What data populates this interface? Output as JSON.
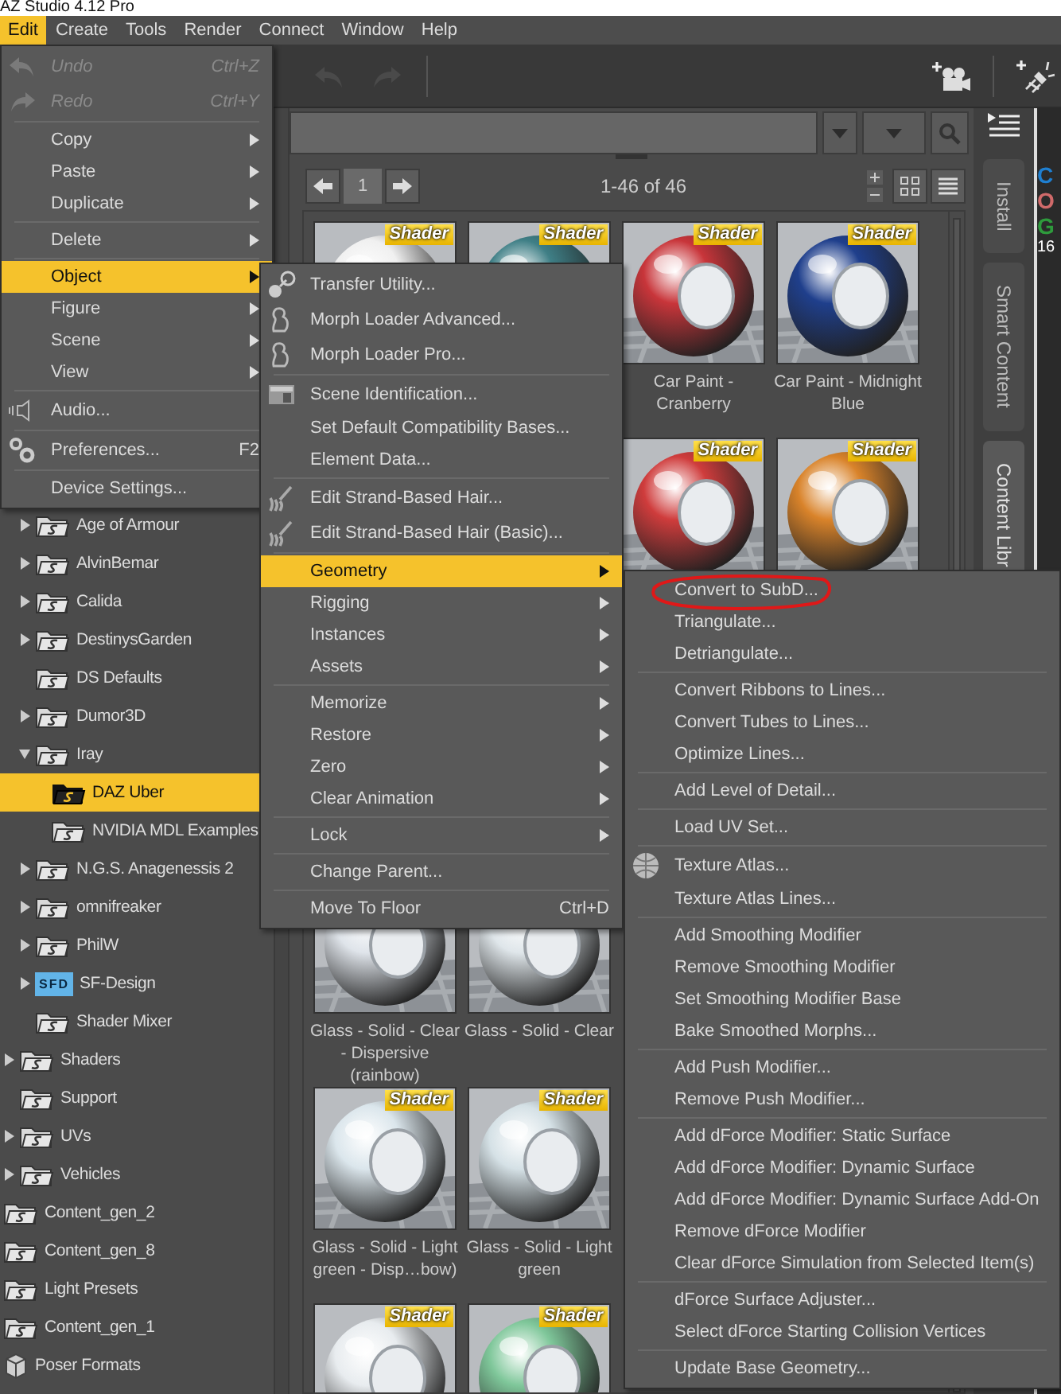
{
  "window": {
    "title": "AZ Studio 4.12 Pro"
  },
  "menubar": [
    {
      "label": "Edit",
      "selected": true
    },
    {
      "label": "Create",
      "selected": false
    },
    {
      "label": "Tools",
      "selected": false
    },
    {
      "label": "Render",
      "selected": false
    },
    {
      "label": "Connect",
      "selected": false
    },
    {
      "label": "Window",
      "selected": false
    },
    {
      "label": "Help",
      "selected": false
    }
  ],
  "tree": [
    {
      "children": [
        {
          "children": [
            {
              "label": "Age of Armour",
              "expanded": false,
              "selected": false,
              "kind": "folder"
            },
            {
              "label": "AlvinBemar",
              "expanded": false,
              "selected": false,
              "kind": "folder"
            },
            {
              "label": "Calida",
              "expanded": false,
              "selected": false,
              "kind": "folder"
            },
            {
              "label": "DestinysGarden",
              "expanded": false,
              "selected": false,
              "kind": "folder"
            },
            {
              "label": "DS Defaults",
              "selected": false,
              "kind": "folder"
            },
            {
              "label": "Dumor3D",
              "expanded": false,
              "selected": false,
              "kind": "folder"
            },
            {
              "label": "Iray",
              "expanded": true,
              "selected": false,
              "kind": "folder",
              "children": [
                {
                  "label": "DAZ Uber",
                  "selected": true,
                  "kind": "folder"
                },
                {
                  "label": "NVIDIA MDL Examples",
                  "selected": false,
                  "kind": "folder"
                }
              ]
            },
            {
              "label": "N.G.S. Anagenessis 2",
              "expanded": false,
              "selected": false,
              "kind": "folder"
            },
            {
              "label": "omnifreaker",
              "expanded": false,
              "selected": false,
              "kind": "folder"
            },
            {
              "label": "PhilW",
              "expanded": false,
              "selected": false,
              "kind": "folder"
            },
            {
              "label": "SF-Design",
              "expanded": false,
              "selected": false,
              "kind": "logo",
              "logo": "SFD"
            },
            {
              "label": "Shader Mixer",
              "selected": false,
              "kind": "folder"
            }
          ]
        },
        {
          "label": "Shaders",
          "expanded": false,
          "selected": false,
          "kind": "folder"
        },
        {
          "label": "Support",
          "selected": false,
          "kind": "folder"
        },
        {
          "label": "UVs",
          "expanded": false,
          "selected": false,
          "kind": "folder"
        },
        {
          "label": "Vehicles",
          "expanded": false,
          "selected": false,
          "kind": "folder"
        }
      ]
    },
    {
      "label": "Content_gen_2",
      "selected": false,
      "kind": "folder"
    },
    {
      "label": "Content_gen_8",
      "selected": false,
      "kind": "folder"
    },
    {
      "label": "Light Presets",
      "selected": false,
      "kind": "folder"
    },
    {
      "label": "Content_gen_1",
      "selected": false,
      "kind": "folder"
    },
    {
      "label": "Poser Formats",
      "selected": false,
      "kind": "package"
    }
  ],
  "pagination": {
    "page": "1",
    "range": "1-46 of 46"
  },
  "tiles": [
    {
      "kind": "shader",
      "badge": "Shader"
    },
    {
      "kind": "shader",
      "badge": "Shader"
    },
    {
      "kind": "shader",
      "badge": "Shader",
      "label": "Car Paint - Cranberry"
    },
    {
      "kind": "shader",
      "badge": "Shader",
      "label": "Car Paint - Midnight Blue"
    },
    {
      "kind": "covered"
    },
    {
      "kind": "covered"
    },
    {
      "kind": "shader",
      "badge": "Shader"
    },
    {
      "kind": "shader",
      "badge": "Shader"
    },
    {
      "kind": "covered"
    },
    {
      "kind": "covered"
    },
    {
      "kind": "covered"
    },
    {
      "kind": "covered"
    },
    {
      "kind": "shader-lower",
      "label": "Glass - Solid - Clear - Dispersive (rainbow)"
    },
    {
      "kind": "shader-lower",
      "label": "Glass - Solid - Clear"
    },
    {
      "kind": "covered"
    },
    {
      "kind": "covered"
    },
    {
      "kind": "shader",
      "badge": "Shader",
      "label": "Glass - Solid - Light green - Disp…bow)"
    },
    {
      "kind": "shader",
      "badge": "Shader",
      "label": "Glass - Solid - Light green"
    },
    {
      "kind": "covered"
    },
    {
      "kind": "covered"
    },
    {
      "kind": "shader",
      "badge": "Shader"
    },
    {
      "kind": "shader",
      "badge": "Shader"
    }
  ],
  "side_tabs": [
    {
      "label": "Install",
      "selected": false
    },
    {
      "label": "Smart Content",
      "selected": false
    },
    {
      "label": "Content Libr",
      "selected": true
    }
  ],
  "viewport": {
    "labels": [
      {
        "text": "C",
        "color": "#1f7fd0"
      },
      {
        "text": "O",
        "color": "#d06a6a"
      },
      {
        "text": "G",
        "color": "#2e9a3c"
      }
    ],
    "counter": "16"
  },
  "edit_menu": {
    "items": [
      {
        "kind": "item",
        "label": "Undo",
        "shortcut": "Ctrl+Z",
        "disabled": true,
        "selected": false,
        "submenu": false
      },
      {
        "kind": "item",
        "label": "Redo",
        "shortcut": "Ctrl+Y",
        "disabled": true,
        "selected": false,
        "submenu": false
      },
      {
        "kind": "separator"
      },
      {
        "kind": "item",
        "label": "Copy",
        "disabled": false,
        "selected": false,
        "submenu": true
      },
      {
        "kind": "item",
        "label": "Paste",
        "disabled": false,
        "selected": false,
        "submenu": true
      },
      {
        "kind": "item",
        "label": "Duplicate",
        "disabled": false,
        "selected": false,
        "submenu": true
      },
      {
        "kind": "separator"
      },
      {
        "kind": "item",
        "label": "Delete",
        "disabled": false,
        "selected": false,
        "submenu": true
      },
      {
        "kind": "separator"
      },
      {
        "kind": "item",
        "label": "Object",
        "disabled": false,
        "selected": true,
        "submenu": true
      },
      {
        "kind": "item",
        "label": "Figure",
        "disabled": false,
        "selected": false,
        "submenu": true
      },
      {
        "kind": "item",
        "label": "Scene",
        "disabled": false,
        "selected": false,
        "submenu": true
      },
      {
        "kind": "item",
        "label": "View",
        "disabled": false,
        "selected": false,
        "submenu": true
      },
      {
        "kind": "separator"
      },
      {
        "kind": "item",
        "label": "Audio...",
        "disabled": false,
        "selected": false,
        "submenu": false
      },
      {
        "kind": "separator"
      },
      {
        "kind": "item",
        "label": "Preferences...",
        "shortcut": "F2",
        "disabled": false,
        "selected": false,
        "submenu": false
      },
      {
        "kind": "separator"
      },
      {
        "kind": "item",
        "label": "Device Settings...",
        "disabled": false,
        "selected": false,
        "submenu": false
      }
    ]
  },
  "object_menu": {
    "items": [
      {
        "kind": "item",
        "label": "Transfer Utility...",
        "disabled": false,
        "selected": false,
        "submenu": false
      },
      {
        "kind": "item",
        "label": "Morph Loader Advanced...",
        "disabled": false,
        "selected": false,
        "submenu": false
      },
      {
        "kind": "item",
        "label": "Morph Loader Pro...",
        "disabled": false,
        "selected": false,
        "submenu": false
      },
      {
        "kind": "separator"
      },
      {
        "kind": "item",
        "label": "Scene Identification...",
        "disabled": false,
        "selected": false,
        "submenu": false
      },
      {
        "kind": "item",
        "label": "Set Default Compatibility Bases...",
        "disabled": false,
        "selected": false,
        "submenu": false
      },
      {
        "kind": "item",
        "label": "Element Data...",
        "disabled": false,
        "selected": false,
        "submenu": false
      },
      {
        "kind": "separator"
      },
      {
        "kind": "item",
        "label": "Edit Strand-Based Hair...",
        "disabled": false,
        "selected": false,
        "submenu": false
      },
      {
        "kind": "item",
        "label": "Edit Strand-Based Hair (Basic)...",
        "disabled": false,
        "selected": false,
        "submenu": false
      },
      {
        "kind": "separator"
      },
      {
        "kind": "item",
        "label": "Geometry",
        "disabled": false,
        "selected": true,
        "submenu": true
      },
      {
        "kind": "item",
        "label": "Rigging",
        "disabled": false,
        "selected": false,
        "submenu": true
      },
      {
        "kind": "item",
        "label": "Instances",
        "disabled": false,
        "selected": false,
        "submenu": true
      },
      {
        "kind": "item",
        "label": "Assets",
        "disabled": false,
        "selected": false,
        "submenu": true
      },
      {
        "kind": "separator"
      },
      {
        "kind": "item",
        "label": "Memorize",
        "disabled": false,
        "selected": false,
        "submenu": true
      },
      {
        "kind": "item",
        "label": "Restore",
        "disabled": false,
        "selected": false,
        "submenu": true
      },
      {
        "kind": "item",
        "label": "Zero",
        "disabled": false,
        "selected": false,
        "submenu": true
      },
      {
        "kind": "item",
        "label": "Clear Animation",
        "disabled": false,
        "selected": false,
        "submenu": true
      },
      {
        "kind": "separator"
      },
      {
        "kind": "item",
        "label": "Lock",
        "disabled": false,
        "selected": false,
        "submenu": true
      },
      {
        "kind": "separator"
      },
      {
        "kind": "item",
        "label": "Change Parent...",
        "disabled": false,
        "selected": false,
        "submenu": false
      },
      {
        "kind": "separator"
      },
      {
        "kind": "item",
        "label": "Move To Floor",
        "shortcut": "Ctrl+D",
        "disabled": false,
        "selected": false,
        "submenu": false
      }
    ]
  },
  "geometry_menu": {
    "items": [
      {
        "kind": "item",
        "label": "Convert to SubD...",
        "circled": true
      },
      {
        "kind": "item",
        "label": "Triangulate...",
        "circled": false
      },
      {
        "kind": "item",
        "label": "Detriangulate...",
        "circled": false
      },
      {
        "kind": "separator"
      },
      {
        "kind": "item",
        "label": "Convert Ribbons to Lines...",
        "circled": false
      },
      {
        "kind": "item",
        "label": "Convert Tubes to Lines...",
        "circled": false
      },
      {
        "kind": "item",
        "label": "Optimize Lines...",
        "circled": false
      },
      {
        "kind": "separator"
      },
      {
        "kind": "item",
        "label": "Add Level of Detail...",
        "circled": false
      },
      {
        "kind": "separator"
      },
      {
        "kind": "item",
        "label": "Load UV Set...",
        "circled": false
      },
      {
        "kind": "separator"
      },
      {
        "kind": "item",
        "label": "Texture Atlas...",
        "circled": false
      },
      {
        "kind": "item",
        "label": "Texture Atlas Lines...",
        "circled": false
      },
      {
        "kind": "separator"
      },
      {
        "kind": "item",
        "label": "Add Smoothing Modifier",
        "circled": false
      },
      {
        "kind": "item",
        "label": "Remove Smoothing Modifier",
        "circled": false
      },
      {
        "kind": "item",
        "label": "Set Smoothing Modifier Base",
        "circled": false
      },
      {
        "kind": "item",
        "label": "Bake Smoothed Morphs...",
        "circled": false
      },
      {
        "kind": "separator"
      },
      {
        "kind": "item",
        "label": "Add Push Modifier...",
        "circled": false
      },
      {
        "kind": "item",
        "label": "Remove Push Modifier...",
        "circled": false
      },
      {
        "kind": "separator"
      },
      {
        "kind": "item",
        "label": "Add dForce Modifier: Static Surface",
        "circled": false
      },
      {
        "kind": "item",
        "label": "Add dForce Modifier: Dynamic Surface",
        "circled": false
      },
      {
        "kind": "item",
        "label": "Add dForce Modifier: Dynamic Surface Add-On",
        "circled": false
      },
      {
        "kind": "item",
        "label": "Remove dForce Modifier",
        "circled": false
      },
      {
        "kind": "item",
        "label": "Clear dForce Simulation from Selected Item(s)",
        "circled": false
      },
      {
        "kind": "separator"
      },
      {
        "kind": "item",
        "label": "dForce Surface Adjuster...",
        "circled": false
      },
      {
        "kind": "item",
        "label": "Select dForce Starting Collision Vertices",
        "circled": false
      },
      {
        "kind": "separator"
      },
      {
        "kind": "item",
        "label": "Update Base Geometry...",
        "circled": false
      }
    ]
  }
}
